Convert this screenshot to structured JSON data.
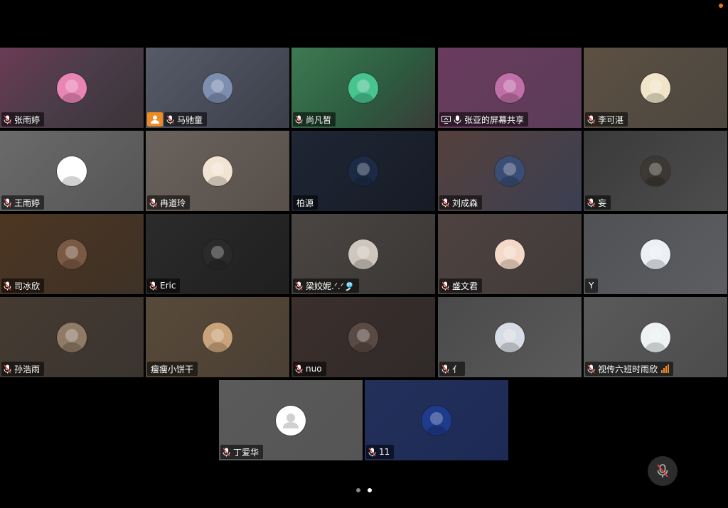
{
  "status_dot_color": "#e8751a",
  "participants": [
    {
      "name": "张雨婷",
      "mic": "muted",
      "bg": "linear-gradient(135deg,#6b3b55,#4a3c48 50%,#3a3438)",
      "avatar": "#e985b5"
    },
    {
      "name": "马驰童",
      "mic": "muted",
      "host": true,
      "bg": "linear-gradient(135deg,#575b68,#3b3f4a)",
      "avatar": "#7d8fb0"
    },
    {
      "name": "尚凡皙",
      "mic": "muted",
      "bg": "linear-gradient(135deg,#3d7a52,#2d5a3f 60%,#3a3c38)",
      "avatar": "#48c490"
    },
    {
      "name": "张亚的屏幕共享",
      "mic": "on",
      "sharing": true,
      "bg": "linear-gradient(135deg,#6a3b5e,#5a3d58)",
      "avatar": "#c06fa8"
    },
    {
      "name": "李可湛",
      "mic": "muted",
      "bg": "linear-gradient(135deg,#5d5042,#4b4740)",
      "avatar": "#f0e5c8"
    },
    {
      "name": "王雨婷",
      "mic": "muted",
      "bg": "linear-gradient(135deg,#6a6a6a,#555555)",
      "avatar": "#ffffff"
    },
    {
      "name": "冉道玲",
      "mic": "muted",
      "bg": "linear-gradient(135deg,#6a625c,#584f4a)",
      "avatar": "#f1e4d2"
    },
    {
      "name": "柏源",
      "mic": "none",
      "bg": "linear-gradient(135deg,#1f2634,#161b26)",
      "avatar": "#1b2b45"
    },
    {
      "name": "刘成森",
      "mic": "muted",
      "bg": "linear-gradient(135deg,#55403c,#3b3f52)",
      "avatar": "#3a4d74"
    },
    {
      "name": "妄",
      "mic": "muted",
      "bg": "linear-gradient(135deg,#3a3a3a,#4d4d4d)",
      "avatar": "#3c3833"
    },
    {
      "name": "司冰欣",
      "mic": "muted",
      "bg": "linear-gradient(135deg,#4d3622,#3d3126)",
      "avatar": "#7a5a45"
    },
    {
      "name": "Eric",
      "mic": "muted",
      "bg": "linear-gradient(135deg,#2b2b2b,#1f1f1f)",
      "avatar": "#2a2a2a"
    },
    {
      "name": "梁姣妮.ᐟ.ᐟ🎐",
      "mic": "muted",
      "bg": "linear-gradient(135deg,#4a4542,#3a3735)",
      "avatar": "#cfc6bd"
    },
    {
      "name": "盛文君",
      "mic": "muted",
      "bg": "linear-gradient(135deg,#4e4240,#403b3a)",
      "avatar": "#f5d9c8"
    },
    {
      "name": "Y",
      "mic": "none",
      "bg": "linear-gradient(135deg,#4f5154,#5c5e62)",
      "avatar": "#ecf0f4"
    },
    {
      "name": "孙浩雨",
      "mic": "muted",
      "bg": "linear-gradient(135deg,#453b32,#3a342f)",
      "avatar": "#8f7b66"
    },
    {
      "name": "瘦瘦小饼干",
      "mic": "none",
      "bg": "linear-gradient(135deg,#584a3a,#4a3f34)",
      "avatar": "#c9a37a"
    },
    {
      "name": "nuo",
      "mic": "muted",
      "bg": "linear-gradient(135deg,#3c2f2c,#2f2a29)",
      "avatar": "#5a4a44"
    },
    {
      "name": "亻",
      "mic": "muted",
      "bg": "linear-gradient(135deg,#4a4a4a,#5a5a5a)",
      "avatar": "#d8dce4"
    },
    {
      "name": "视传六班时雨欣",
      "mic": "muted",
      "signal": true,
      "bg": "linear-gradient(135deg,#5a5a5a,#4c4c4c)",
      "avatar": "#eef2f2"
    },
    {
      "name": "丁爱华",
      "mic": "muted",
      "bg": "linear-gradient(135deg,#5a5a5a,#555555)",
      "avatar": "#ffffff",
      "default_avatar": true
    },
    {
      "name": "11",
      "mic": "muted",
      "bg": "linear-gradient(135deg,#22305a,#1c2a55)",
      "avatar": "#1e3b8c"
    }
  ],
  "pagination": {
    "pages": 2,
    "current": 2
  },
  "controls": {
    "mute_label": "mute"
  }
}
